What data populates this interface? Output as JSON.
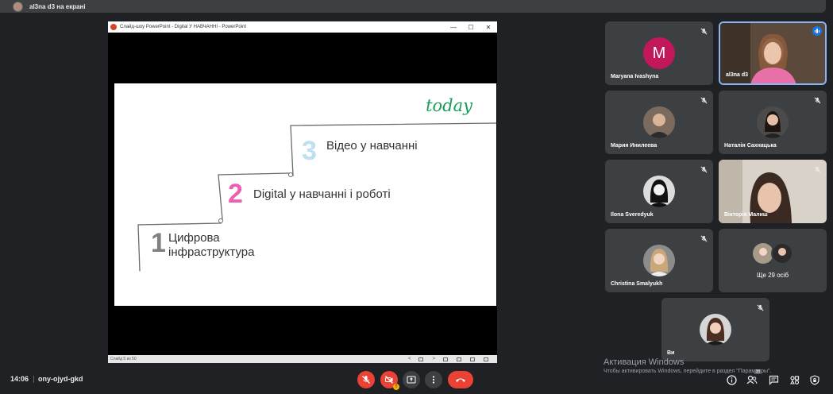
{
  "top_bar": {
    "presenter_label": "al3na d3 на екрані"
  },
  "presentation": {
    "window_title": "Слайд-шоу PowerPoint  -  Digital У НАВЧАННІ - PowerPoint",
    "window_controls": [
      "—",
      "☐",
      "✕"
    ],
    "slide": {
      "heading": "today",
      "steps": [
        {
          "number": "1",
          "text": "Цифрова\nінфраструктура",
          "color": "#808080"
        },
        {
          "number": "2",
          "text": "Digital у навчанні і роботі",
          "color": "#ec5fb3"
        },
        {
          "number": "3",
          "text": "Відео у навчанні",
          "color": "#bfe0f2"
        }
      ]
    },
    "status": {
      "slide_counter": "Слайд 5 из 50"
    }
  },
  "participants": [
    {
      "name": "Maryana Ivashyna",
      "avatar_letter": "M"
    },
    {
      "name": "al3na d3"
    },
    {
      "name": "Мария Инилеева"
    },
    {
      "name": "Наталія Сахнацька"
    },
    {
      "name": "Ilona Sveredyuk"
    },
    {
      "name": "Вікторія Малиш"
    },
    {
      "name": "Christina Smalyukh"
    },
    {
      "more_label": "Ще 29 осіб"
    },
    {
      "name": "Ви"
    }
  ],
  "windows_activation": {
    "title": "Активация Windows",
    "subtitle": "Чтобы активировать Windows, перейдите в раздел \"Параметры\"."
  },
  "bottom_bar": {
    "time": "14:06",
    "meeting_code": "ony-ojyd-gkd",
    "people_count": "38"
  },
  "colors": {
    "background": "#202124",
    "tile": "#3c4043",
    "danger": "#ea4335",
    "speaking": "#1a73e8"
  }
}
